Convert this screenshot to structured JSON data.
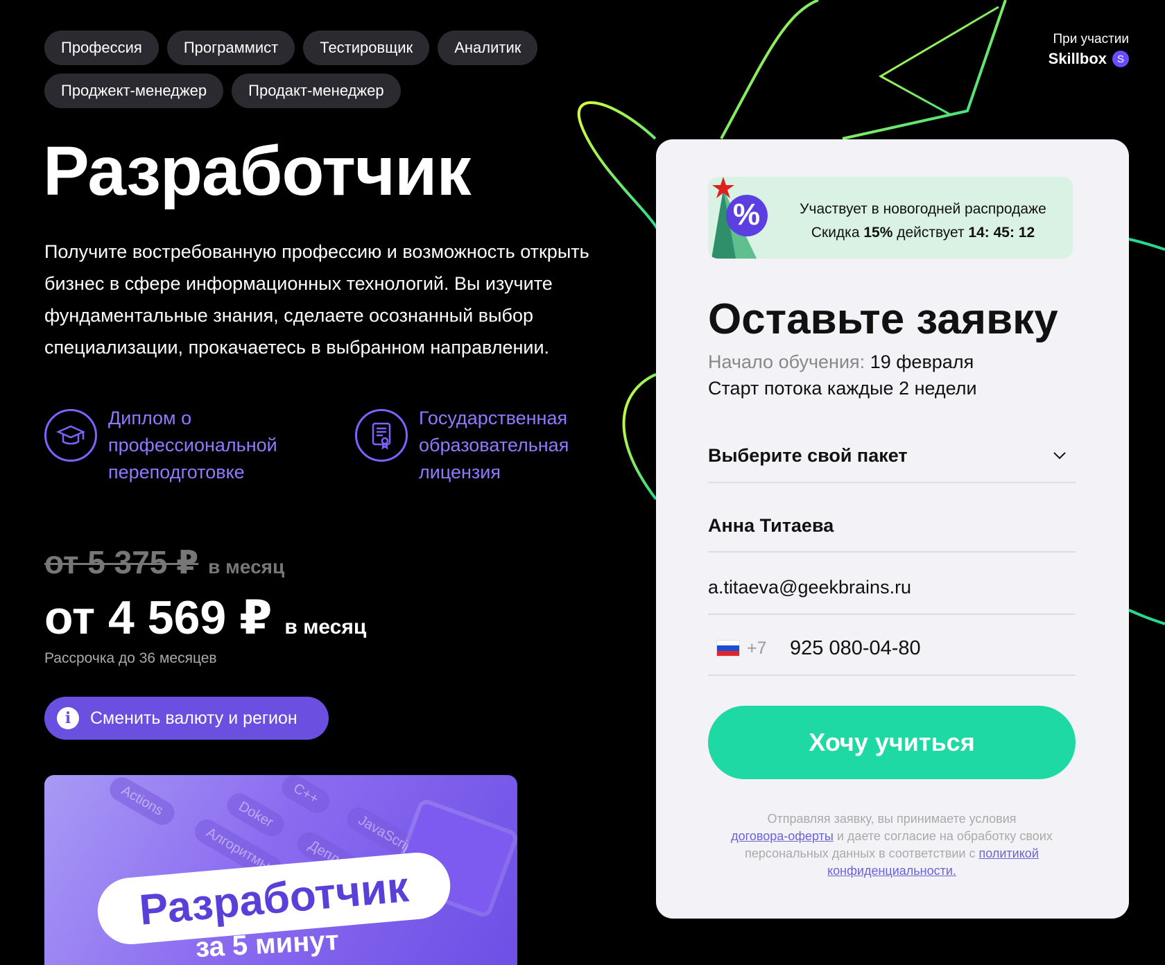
{
  "tags": [
    "Профессия",
    "Программист",
    "Тестировщик",
    "Аналитик",
    "Проджект-менеджер",
    "Продакт-менеджер"
  ],
  "partner": {
    "with": "При участии",
    "brand": "Skillbox",
    "logo_letter": "S"
  },
  "title": "Разработчик",
  "lead": "Получите востребованную профессию и возможность открыть бизнес в сфере информационных технологий. Вы изучите фундаментальные знания, сделаете осознанный выбор специализации, прокачаетесь в выбранном направлении.",
  "features": [
    {
      "text": "Диплом о профессиональной переподготовке",
      "icon": "graduation-cap-icon"
    },
    {
      "text": "Государственная образовательная лицензия",
      "icon": "certificate-icon"
    }
  ],
  "pricing": {
    "old_value": "от 5 375 ₽",
    "old_unit": "в месяц",
    "value": "от 4 569 ₽",
    "unit": "в месяц",
    "installment": "Рассрочка до 36 месяцев"
  },
  "currency_button": {
    "label": "Сменить валюту и регион",
    "icon": "info-icon",
    "icon_glyph": "i"
  },
  "video": {
    "title": "Разработчик",
    "subtitle": "за 5 минут",
    "chips": [
      "Actions",
      "C++",
      "Doker",
      "Алгоритмы",
      "JavaScript",
      "Деплой"
    ]
  },
  "form": {
    "promo_line1": "Участвует в новогодней распродаже",
    "promo_pre": "Скидка",
    "promo_discount": "15%",
    "promo_mid": "действует",
    "promo_timer": "14: 45: 12",
    "promo_badge": "%",
    "heading": "Оставьте заявку",
    "start_label": "Начало обучения:",
    "start_date": "19 февраля",
    "stream": "Старт потока каждые 2 недели",
    "package_placeholder": "Выберите свой пакет",
    "name": "Анна Титаева",
    "email": "a.titaeva@geekbrains.ru",
    "phone_code": "+7",
    "phone": "925 080-04-80",
    "submit": "Хочу учиться",
    "legal_1": "Отправляя заявку, вы принимаете условия",
    "legal_link1": "договора-оферты",
    "legal_2": "и даете согласие на обработку своих персональных данных в соответствии с",
    "legal_link2": "политикой конфиденциальности."
  },
  "colors": {
    "accent_purple": "#6a4fe0",
    "feature_purple": "#8f79ff",
    "submit_green": "#1ed9a3",
    "deco_green": "#7dea3a"
  }
}
